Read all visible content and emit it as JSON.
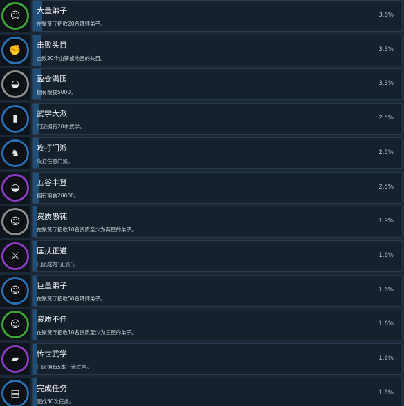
{
  "achievements": [
    {
      "title": "大量弟子",
      "description": "在聚贤厅招收20名拜师弟子。",
      "percent": "3.6%",
      "ring_color": "#3fa33a",
      "icon": "disciple-icon",
      "glyph": "☺"
    },
    {
      "title": "击败头目",
      "description": "击败20个山寨或地宫的头目。",
      "percent": "3.3%",
      "ring_color": "#2b6fb3",
      "icon": "arm-flex-icon",
      "glyph": "✊"
    },
    {
      "title": "盈仓满囤",
      "description": "拥有粮食5000。",
      "percent": "3.3%",
      "ring_color": "#8f8f8f",
      "icon": "rice-bowl-icon",
      "glyph": "◒"
    },
    {
      "title": "武学大派",
      "description": "门派拥有20本武学。",
      "percent": "2.5%",
      "ring_color": "#2b6fb3",
      "icon": "scroll-icon",
      "glyph": "▮"
    },
    {
      "title": "攻打门派",
      "description": "攻打任意门派。",
      "percent": "2.5%",
      "ring_color": "#2b6fb3",
      "icon": "warrior-icon",
      "glyph": "♞"
    },
    {
      "title": "五谷丰登",
      "description": "拥有粮食20000。",
      "percent": "2.5%",
      "ring_color": "#8a3cc2",
      "icon": "rice-bowl-icon",
      "glyph": "◒"
    },
    {
      "title": "资质愚钝",
      "description": "在聚贤厅招收10名资质至少为两星的弟子。",
      "percent": "1.9%",
      "ring_color": "#8f8f8f",
      "icon": "disciple-icon",
      "glyph": "☺"
    },
    {
      "title": "匡扶正道",
      "description": "门派成为\"正派\"。",
      "percent": "1.6%",
      "ring_color": "#8a3cc2",
      "icon": "swordsman-icon",
      "glyph": "⚔"
    },
    {
      "title": "巨量弟子",
      "description": "在聚贤厅招收50名拜师弟子。",
      "percent": "1.6%",
      "ring_color": "#2b6fb3",
      "icon": "disciple-icon",
      "glyph": "☺"
    },
    {
      "title": "资质不佳",
      "description": "在聚贤厅招收10名资质至少为三星的弟子。",
      "percent": "1.6%",
      "ring_color": "#3fa33a",
      "icon": "disciple-icon",
      "glyph": "☺"
    },
    {
      "title": "传世武学",
      "description": "门派拥有5本一流武学。",
      "percent": "1.6%",
      "ring_color": "#8a3cc2",
      "icon": "book-icon",
      "glyph": "▰"
    },
    {
      "title": "完成任务",
      "description": "完成50次任务。",
      "percent": "1.6%",
      "ring_color": "#2b6fb3",
      "icon": "task-scroll-icon",
      "glyph": "▤"
    }
  ]
}
